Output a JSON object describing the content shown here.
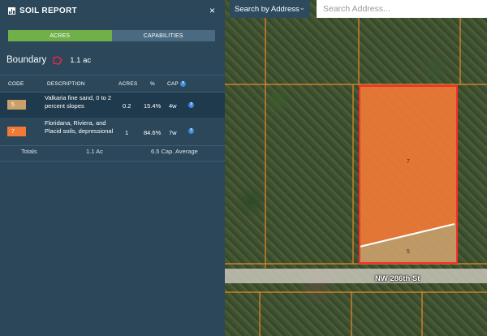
{
  "panel": {
    "title": "SOIL REPORT",
    "close_label": "×",
    "tabs": [
      {
        "label": "ACRES",
        "active": true
      },
      {
        "label": "CAPABILITIES",
        "active": false
      }
    ],
    "boundary_label": "Boundary",
    "boundary_area": "1.1 ac",
    "table": {
      "headers": {
        "code": "CODE",
        "description": "DESCRIPTION",
        "acres": "ACRES",
        "percent": "%",
        "cap": "CAP"
      },
      "rows": [
        {
          "code": "5",
          "description": "Valkaria fine sand, 0 to 2 percent slopes",
          "acres": "0.2",
          "percent": "15.4%",
          "cap": "4w",
          "color": "#c9a06a"
        },
        {
          "code": "7",
          "description": "Floridana, Riviera, and Placid soils, depressional",
          "acres": "1",
          "percent": "84.6%",
          "cap": "7w",
          "color": "#f07a36"
        }
      ],
      "totals": {
        "label": "Totals",
        "acres": "1.1 Ac",
        "cap": "6.5 Cap. Average"
      }
    }
  },
  "map": {
    "search_mode": "Search by Address",
    "search_placeholder": "Search Address...",
    "road_label": "NW 286th St",
    "polygon_labels": [
      "7",
      "5"
    ]
  },
  "colors": {
    "panel_bg": "#2b4759",
    "tab_active": "#6fb04b",
    "parcel_fill": "#f07a36",
    "parcel_border": "#ff2a2a"
  }
}
